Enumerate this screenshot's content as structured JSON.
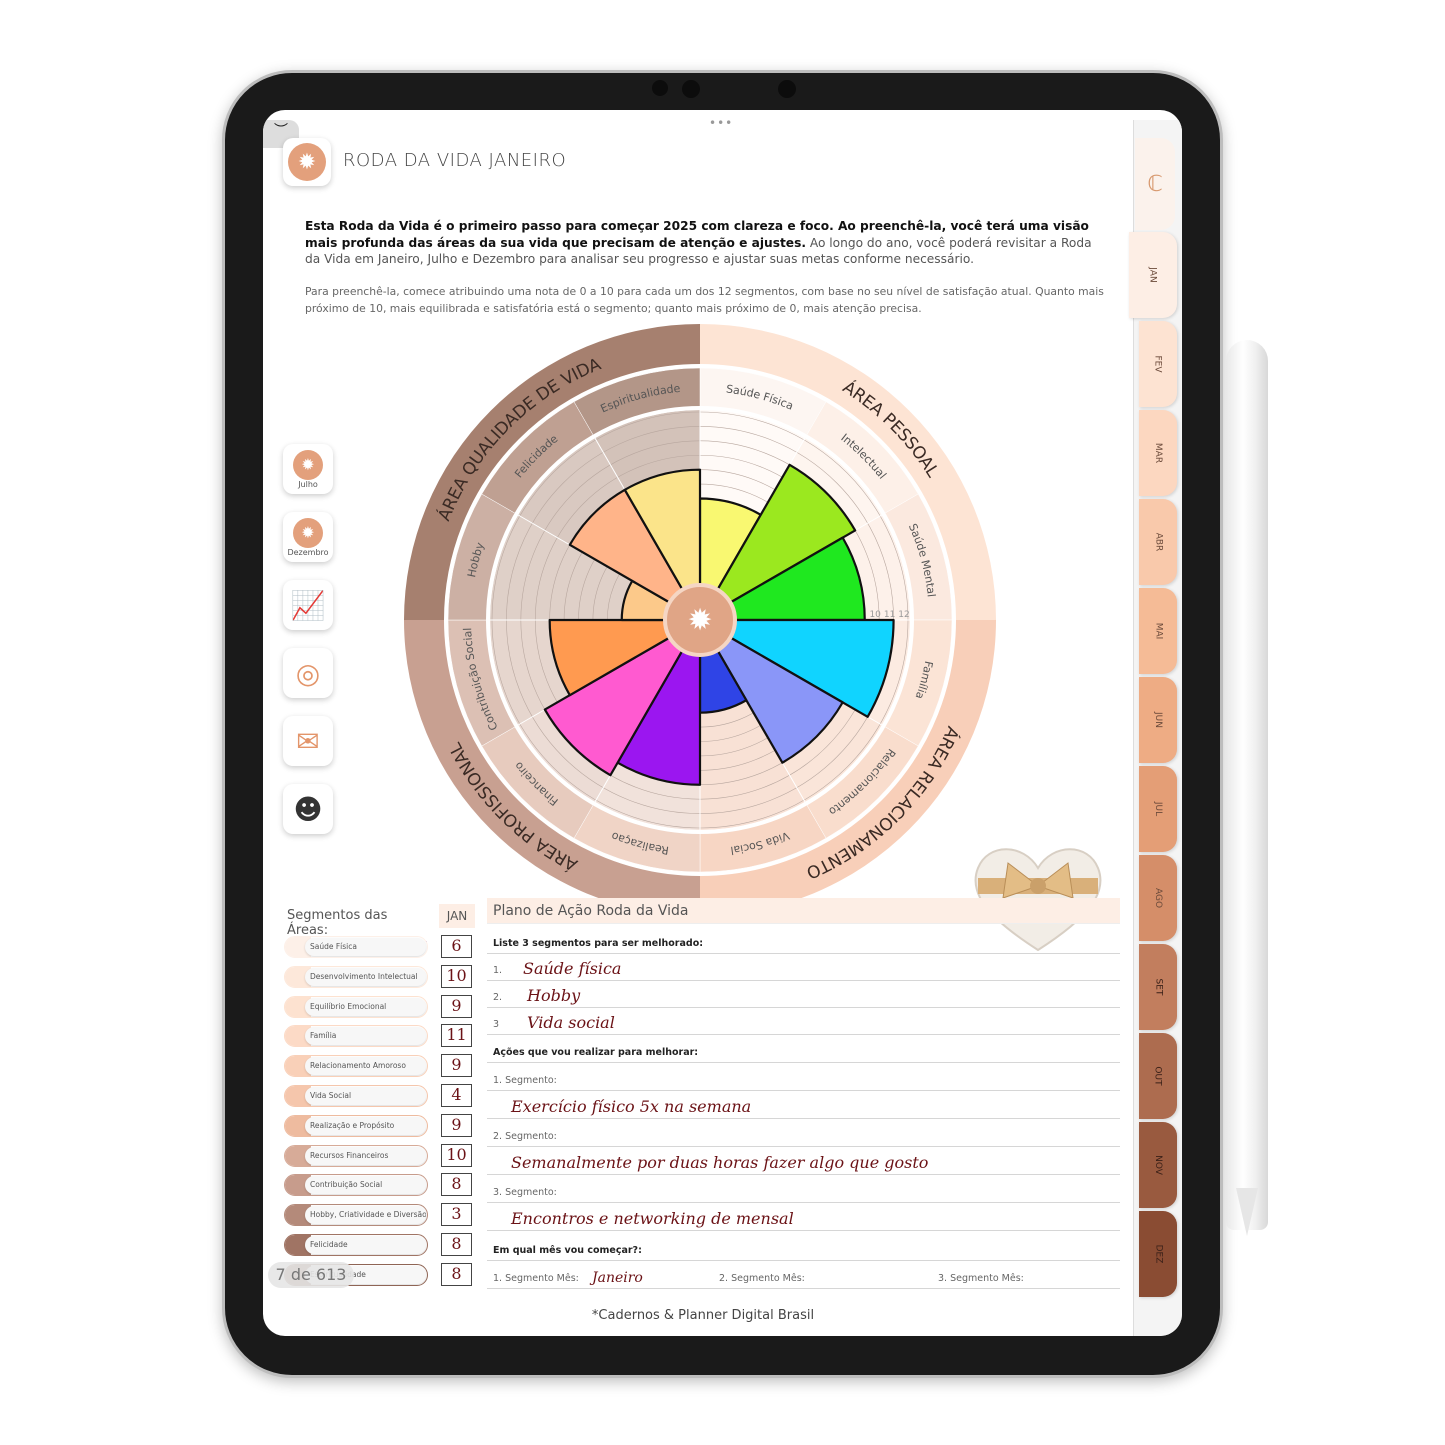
{
  "header": {
    "title": "RODA DA VIDA JANEIRO"
  },
  "intro": {
    "bold": "Esta Roda da Vida é o primeiro passo para começar 2025 com clareza e foco. Ao preenchê-la, você terá uma visão mais profunda das áreas da sua vida que precisam de atenção e ajustes.",
    "rest": " Ao longo do ano, você poderá revisitar a Roda da Vida em Janeiro, Julho e Dezembro para analisar seu progresso e ajustar suas metas conforme necessário.",
    "instructions": "Para preenchê-la, comece atribuindo uma nota de 0 a 10 para cada um dos 12 segmentos, com base no seu nível de satisfação atual. Quanto mais próximo de 10, mais equilibrada e satisfatória está o segmento; quanto mais próximo de 0, mais atenção precisa."
  },
  "sidebar": [
    {
      "label": "Julho",
      "icon": "sun-icon"
    },
    {
      "label": "Dezembro",
      "icon": "sun-icon"
    },
    {
      "label": "",
      "icon": "growth-chart-icon"
    },
    {
      "label": "",
      "icon": "target-icon"
    },
    {
      "label": "",
      "icon": "envelope-heart-icon"
    },
    {
      "label": "",
      "icon": "robot-icon"
    }
  ],
  "chart_data": {
    "type": "polar-bar",
    "scale_max": 12,
    "scale_ticks": [
      "10",
      "11",
      "12"
    ],
    "areas": [
      {
        "name": "ÁREA PESSOAL",
        "color": "#fde4d4"
      },
      {
        "name": "ÁREA RELACIONAMENTO",
        "color": "#f8cfb9"
      },
      {
        "name": "ÁREA PROFISSIONAL",
        "color": "#c8a091"
      },
      {
        "name": "ÁREA QUALIDADE DE VIDA",
        "color": "#a6806f"
      }
    ],
    "segments": [
      {
        "label": "Saúde Física",
        "value": 6,
        "color": "#f9f871"
      },
      {
        "label": "Intelectual",
        "value": 10,
        "color": "#9be81f"
      },
      {
        "label": "Saúde Mental",
        "value": 9,
        "color": "#1fe81f"
      },
      {
        "label": "Família",
        "value": 11,
        "color": "#10d4ff"
      },
      {
        "label": "Relacionamento",
        "value": 9,
        "color": "#8a96f8"
      },
      {
        "label": "Vida Social",
        "value": 4,
        "color": "#2f44e6"
      },
      {
        "label": "Realizaçao",
        "value": 9,
        "color": "#9b16f0"
      },
      {
        "label": "Financeiro",
        "value": 10,
        "color": "#ff5ad0"
      },
      {
        "label": "Contribuição Social",
        "value": 8,
        "color": "#ff9a50"
      },
      {
        "label": "Hobby",
        "value": 3,
        "color": "#fcc98a"
      },
      {
        "label": "Felicidade",
        "value": 8,
        "color": "#ffb489"
      },
      {
        "label": "Espiritualidade",
        "value": 8,
        "color": "#fbe48a"
      }
    ]
  },
  "segments_table": {
    "title": "Segmentos das Áreas:",
    "month": "JAN",
    "rows": [
      {
        "label": "Saúde Física",
        "value": "6"
      },
      {
        "label": "Desenvolvimento Intelectual",
        "value": "10"
      },
      {
        "label": "Equilíbrio Emocional",
        "value": "9"
      },
      {
        "label": "Família",
        "value": "11"
      },
      {
        "label": "Relacionamento Amoroso",
        "value": "9"
      },
      {
        "label": "Vida Social",
        "value": "4"
      },
      {
        "label": "Realização e Propósito",
        "value": "9"
      },
      {
        "label": "Recursos Financeiros",
        "value": "10"
      },
      {
        "label": "Contribuição Social",
        "value": "8"
      },
      {
        "label": "Hobby, Criatividade e Diversão",
        "value": "3"
      },
      {
        "label": "Felicidade",
        "value": "8"
      },
      {
        "label": "Espiritualidade",
        "value": "8"
      }
    ]
  },
  "page_indicator": "7 de 613",
  "plan": {
    "title": "Plano de Ação Roda da Vida",
    "list_label": "Liste 3 segmentos para ser melhorado:",
    "items": [
      {
        "n": "1.",
        "text": "Saúde física"
      },
      {
        "n": "2.",
        "text": "Hobby"
      },
      {
        "n": "3",
        "text": "Vida social"
      }
    ],
    "actions_label": "Ações que vou realizar para melhorar:",
    "actions": [
      {
        "label": "1. Segmento:",
        "text": "Exercício físico 5x na semana"
      },
      {
        "label": "2. Segmento:",
        "text": "Semanalmente por duas horas fazer algo que gosto"
      },
      {
        "label": "3. Segmento:",
        "text": "Encontros e networking de mensal"
      }
    ],
    "month_label": "Em qual mês vou começar?:",
    "months": [
      {
        "label": "1.  Segmento Mês:",
        "text": "Janeiro"
      },
      {
        "label": "2. Segmento Mês:",
        "text": ""
      },
      {
        "label": "3. Segmento Mês:",
        "text": ""
      }
    ]
  },
  "footer": "*Cadernos & Planner Digital Brasil",
  "tabs": [
    {
      "label": "JAN",
      "color": "#fdeee5"
    },
    {
      "label": "FEV",
      "color": "#fde3d2"
    },
    {
      "label": "MAR",
      "color": "#fcd7c0"
    },
    {
      "label": "ABR",
      "color": "#f9c9ab"
    },
    {
      "label": "MAI",
      "color": "#f5bb96"
    },
    {
      "label": "JUN",
      "color": "#eeac84"
    },
    {
      "label": "JUL",
      "color": "#e49e76"
    },
    {
      "label": "AGO",
      "color": "#d58e69"
    },
    {
      "label": "SET",
      "color": "#c27e5e"
    },
    {
      "label": "OUT",
      "color": "#ad6c4f"
    },
    {
      "label": "NOV",
      "color": "#995a3f"
    },
    {
      "label": "DEZ",
      "color": "#8a4c33"
    }
  ]
}
